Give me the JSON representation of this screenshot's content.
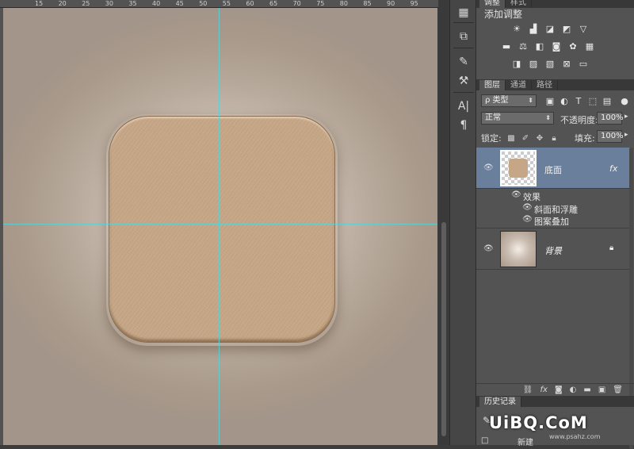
{
  "ruler": {
    "labels": [
      "15",
      "20",
      "25",
      "30",
      "35",
      "40",
      "45",
      "50",
      "55",
      "60",
      "65",
      "70",
      "75",
      "80",
      "85",
      "90",
      "95"
    ]
  },
  "adjustments": {
    "tabs": [
      "调整",
      "样式"
    ],
    "title": "添加调整",
    "row1_icons": [
      "brightness-icon",
      "levels-icon",
      "curves-icon",
      "exposure-icon",
      "vibrance-icon"
    ],
    "row2_icons": [
      "hue-saturation-icon",
      "color-balance-icon",
      "black-white-icon",
      "photo-filter-icon",
      "channel-mixer-icon",
      "color-lookup-icon"
    ],
    "row3_icons": [
      "invert-icon",
      "posterize-icon",
      "threshold-icon",
      "selective-color-icon",
      "gradient-map-icon"
    ]
  },
  "layers": {
    "tabs": [
      "图层",
      "通道",
      "路径"
    ],
    "filter_kind": "类型",
    "filter_prefix": "ρ",
    "blend_mode": "正常",
    "opacity_label": "不透明度:",
    "opacity_value": "100%",
    "lock_label": "锁定:",
    "fill_label": "填充:",
    "fill_value": "100%",
    "items": [
      {
        "name": "底面",
        "fx": "fx",
        "effects_label": "效果",
        "effects": [
          "斜面和浮雕",
          "图案叠加"
        ]
      },
      {
        "name": "背景"
      }
    ]
  },
  "history": {
    "tab": "历史记录",
    "watermark": "UiBQ.CoM",
    "watermark_url": "www.psahz.com",
    "last_item": "新建"
  },
  "colors": {
    "guide": "#59d1d6",
    "tile": "#c5a686",
    "selected_layer": "#6a7f9b",
    "panel": "#535353"
  }
}
